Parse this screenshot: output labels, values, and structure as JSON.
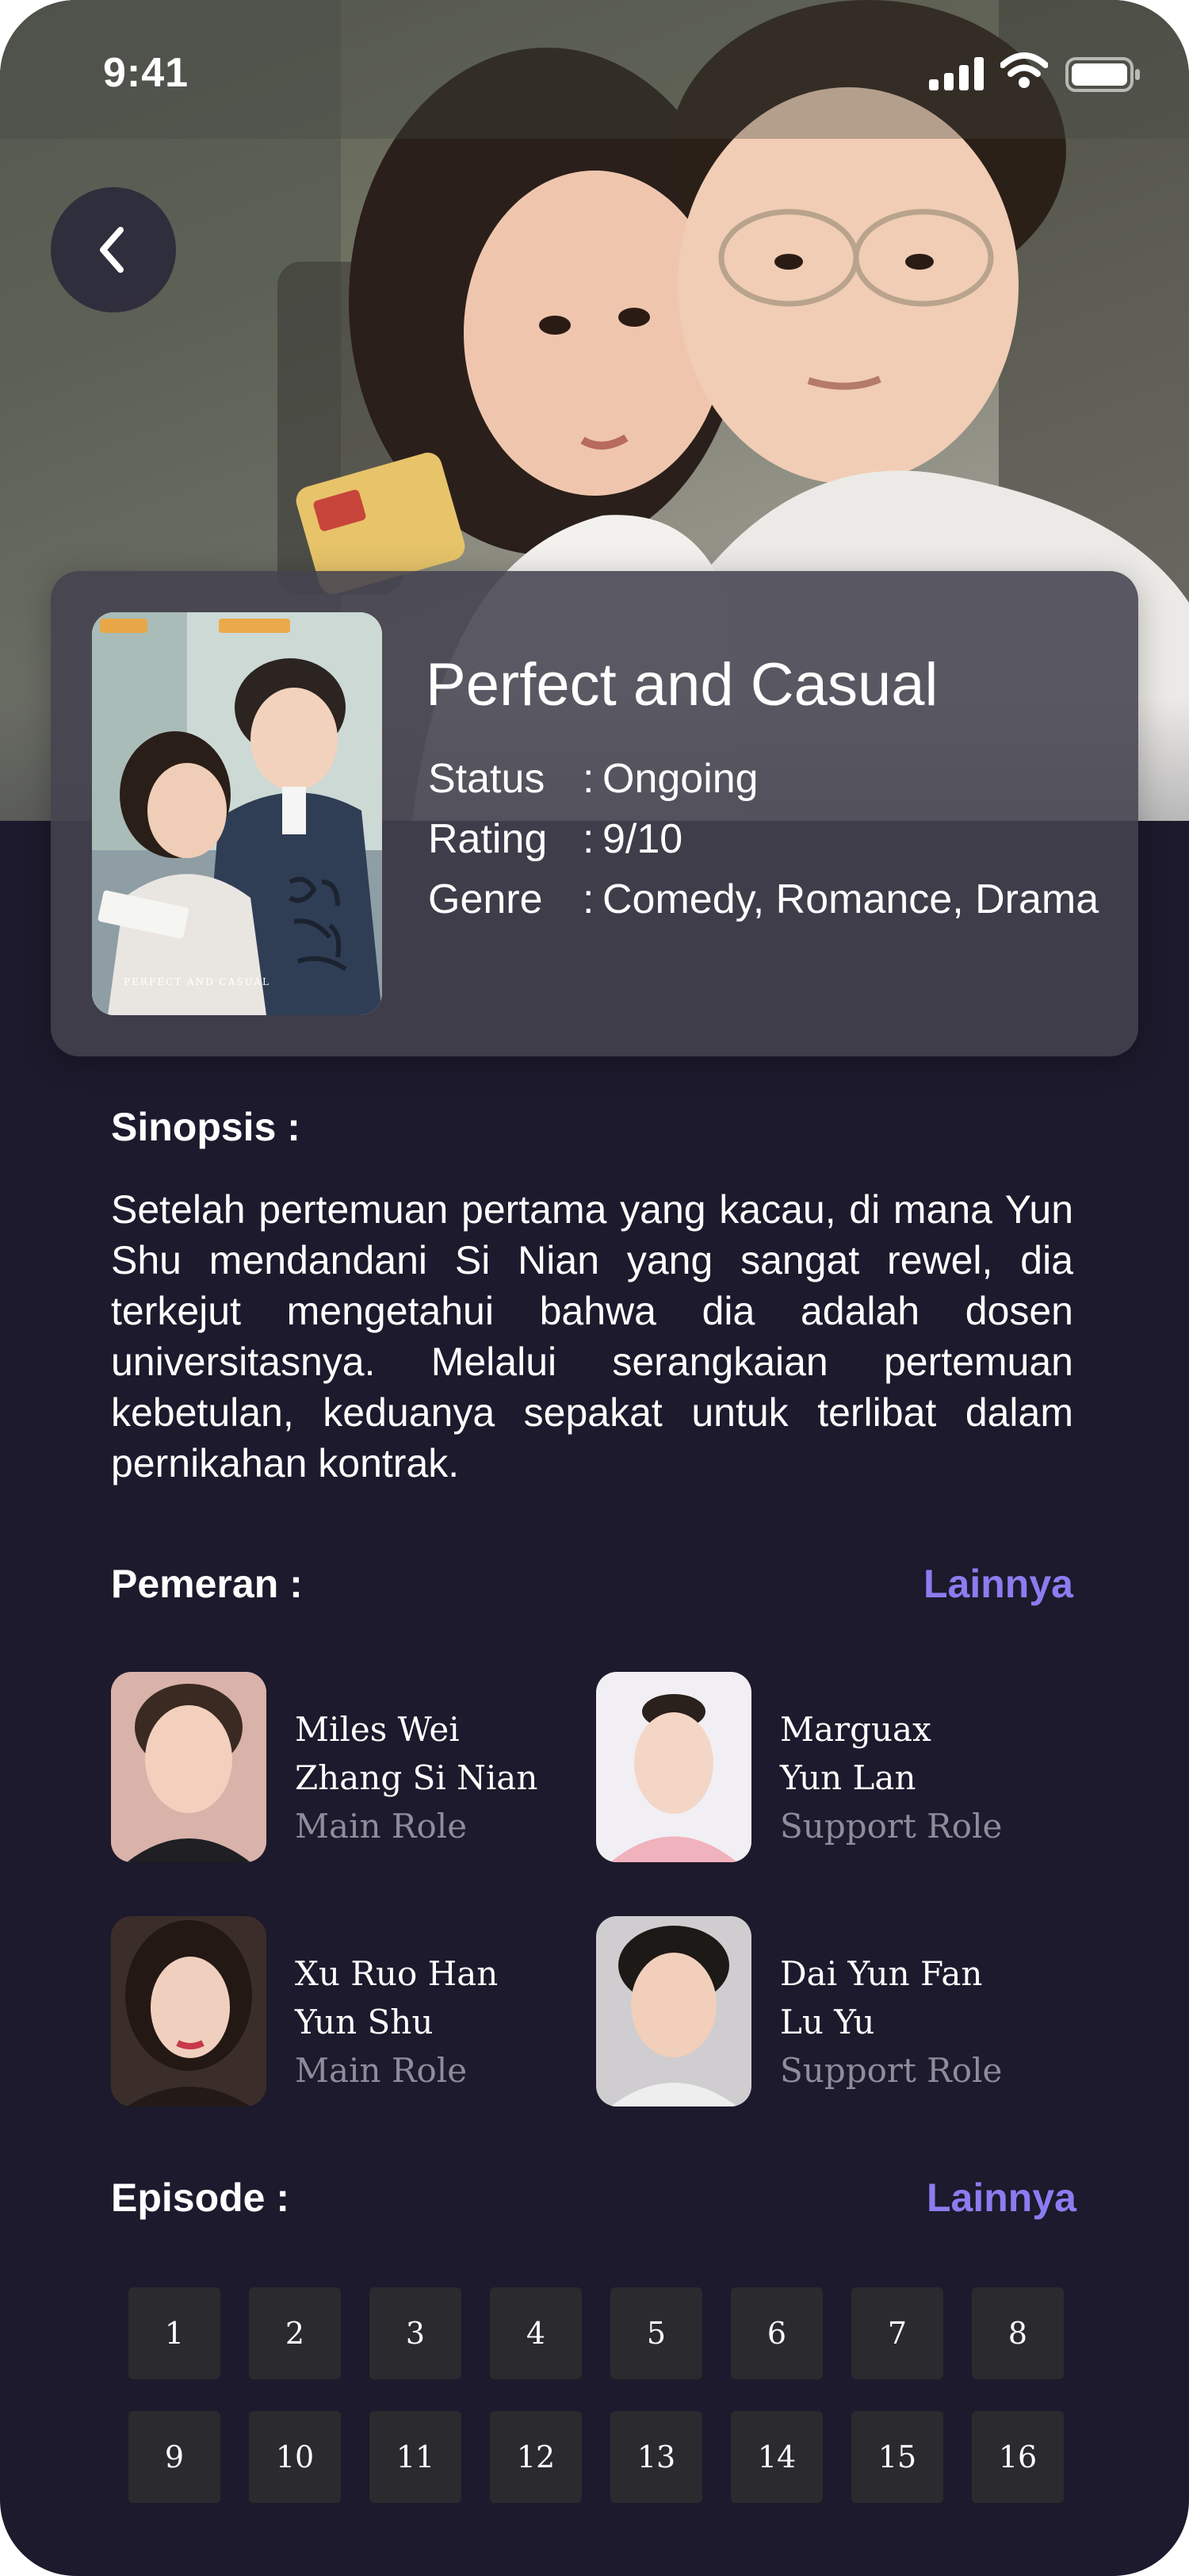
{
  "status_bar": {
    "time": "9:41"
  },
  "movie": {
    "title": "Perfect and Casual",
    "status_label": "Status",
    "status_value": "Ongoing",
    "rating_label": "Rating",
    "rating_value": "9/10",
    "genre_label": "Genre",
    "genre_value": "Comedy, Romance, Drama",
    "separator": ":"
  },
  "synopsis": {
    "label": "Sinopsis :",
    "text": "Setelah pertemuan pertama yang kacau, di mana Yun Shu mendandani Si Nian  yang sangat  rewel, dia terkejut mengetahui bahwa dia  adalah dosen universitasnya. Melalui   serangkaian pertemuan kebetulan, keduanya   sepakat   untuk   terlibat dalam pernikahan kontrak."
  },
  "cast": {
    "label": "Pemeran :",
    "more_label": "Lainnya",
    "members": [
      {
        "actor": "Miles Wei",
        "character": "Zhang Si Nian",
        "role": "Main Role"
      },
      {
        "actor": "Marguax",
        "character": "Yun Lan",
        "role": "Support Role"
      },
      {
        "actor": "Xu Ruo Han",
        "character": "Yun Shu",
        "role": "Main Role"
      },
      {
        "actor": "Dai Yun Fan",
        "character": "Lu Yu",
        "role": "Support Role"
      }
    ]
  },
  "episodes": {
    "label": "Episode :",
    "more_label": "Lainnya",
    "items": [
      "1",
      "2",
      "3",
      "4",
      "5",
      "6",
      "7",
      "8",
      "9",
      "10",
      "11",
      "12",
      "13",
      "14",
      "15",
      "16"
    ]
  },
  "colors": {
    "background": "#1c1a2c",
    "accent": "#8b7cf0",
    "episode_tile": "#2b2a2e",
    "card": "#44424e"
  }
}
